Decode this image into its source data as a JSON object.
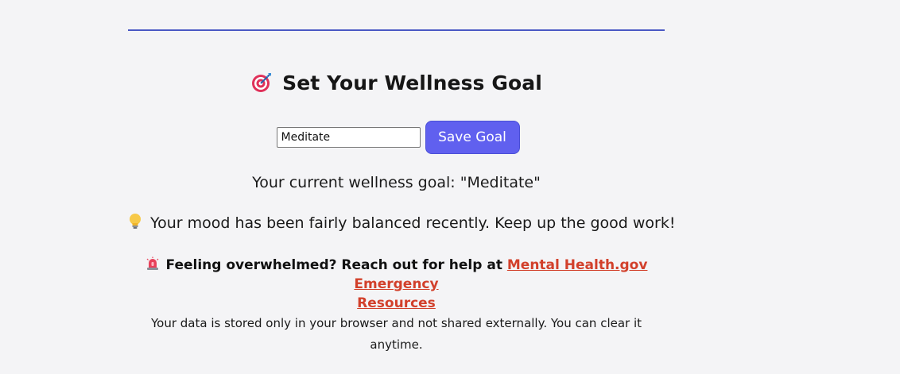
{
  "goal_section": {
    "title": "Set Your Wellness Goal",
    "title_icon": "target-icon",
    "input_value": "Meditate",
    "save_label": "Save Goal",
    "current_goal_text": "Your current wellness goal: \"Meditate\""
  },
  "mood": {
    "icon": "lightbulb-icon",
    "text": "Your mood has been fairly balanced recently. Keep up the good work!"
  },
  "help": {
    "icon": "siren-icon",
    "prefix": "Feeling overwhelmed? Reach out for help at",
    "link_line1": "Mental Health.gov Emergency",
    "link_line2": "Resources"
  },
  "privacy": {
    "line1": "Your data is stored only in your browser and not shared externally. You can clear it",
    "line2": "anytime."
  },
  "colors": {
    "accent_button": "#6060ef",
    "divider": "#4a58c4",
    "link": "#d2402b",
    "background": "#f4f4f6"
  }
}
